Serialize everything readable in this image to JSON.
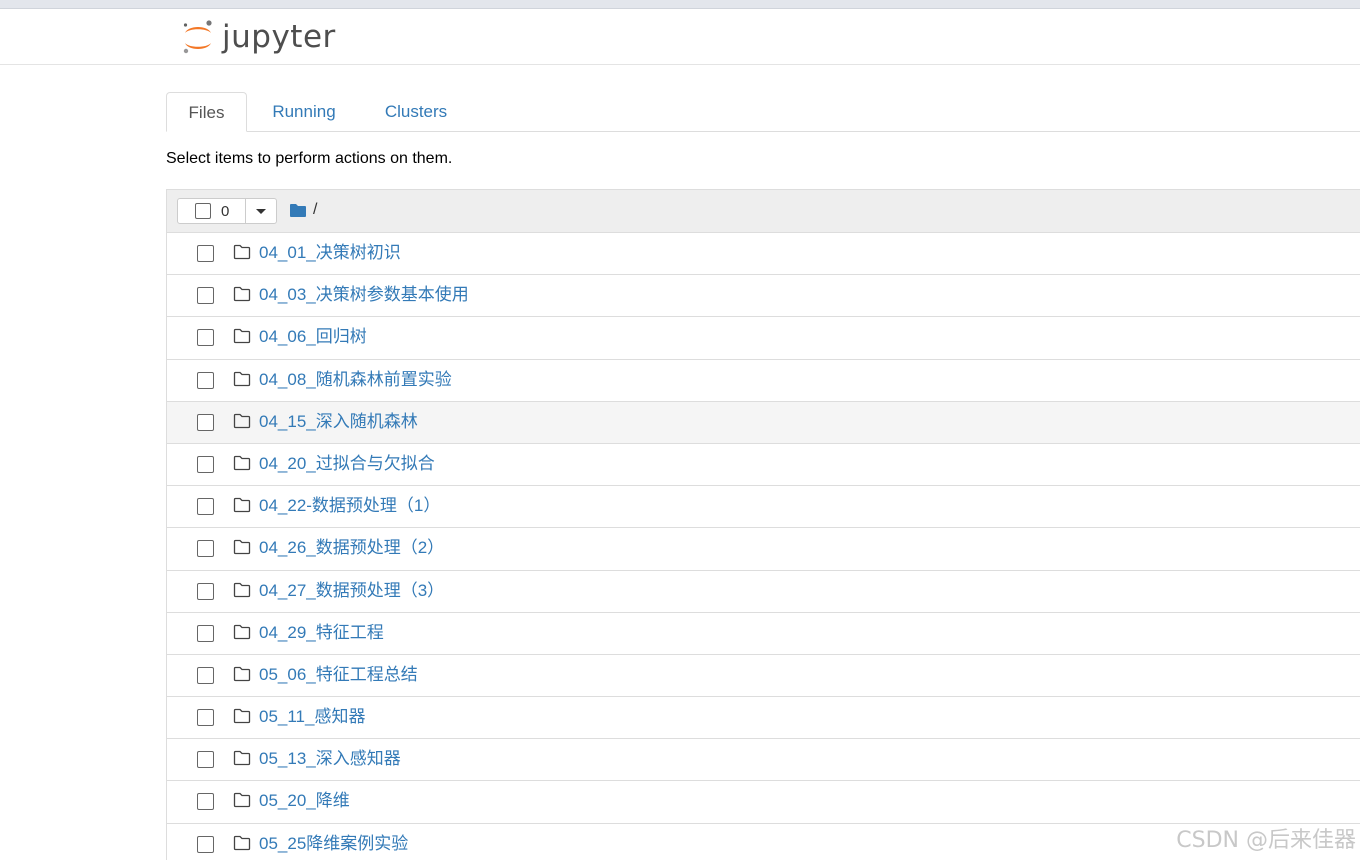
{
  "header": {
    "logo_text": "jupyter"
  },
  "tabs": [
    {
      "label": "Files",
      "active": true
    },
    {
      "label": "Running",
      "active": false
    },
    {
      "label": "Clusters",
      "active": false
    }
  ],
  "hint": "Select items to perform actions on them.",
  "toolbar": {
    "selected_count": "0",
    "breadcrumb_root": "/"
  },
  "files": [
    {
      "name": "04_01_决策树初识",
      "type": "folder"
    },
    {
      "name": "04_03_决策树参数基本使用",
      "type": "folder"
    },
    {
      "name": "04_06_回归树",
      "type": "folder"
    },
    {
      "name": "04_08_随机森林前置实验",
      "type": "folder"
    },
    {
      "name": "04_15_深入随机森林",
      "type": "folder"
    },
    {
      "name": "04_20_过拟合与欠拟合",
      "type": "folder"
    },
    {
      "name": "04_22-数据预处理（1）",
      "type": "folder"
    },
    {
      "name": "04_26_数据预处理（2）",
      "type": "folder"
    },
    {
      "name": "04_27_数据预处理（3）",
      "type": "folder"
    },
    {
      "name": "04_29_特征工程",
      "type": "folder"
    },
    {
      "name": "05_06_特征工程总结",
      "type": "folder"
    },
    {
      "name": "05_11_感知器",
      "type": "folder"
    },
    {
      "name": "05_13_深入感知器",
      "type": "folder"
    },
    {
      "name": "05_20_降维",
      "type": "folder"
    },
    {
      "name": "05_25降维案例实验",
      "type": "folder"
    }
  ],
  "hovered_row": 4,
  "watermark": "CSDN @后来佳器",
  "colors": {
    "link": "#337ab7",
    "jupyter_orange": "#f37726",
    "folder_icon": "#337ab7"
  }
}
